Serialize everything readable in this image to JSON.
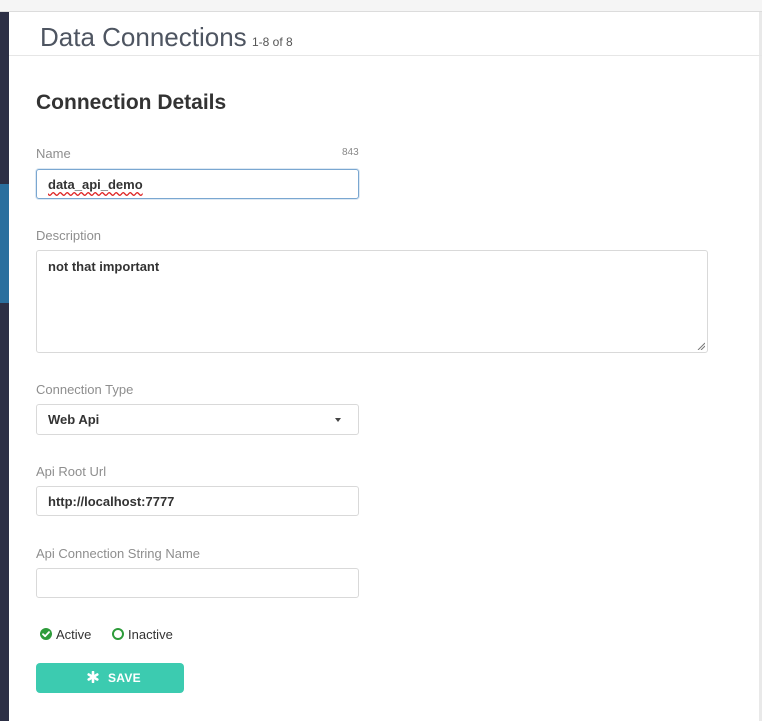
{
  "header": {
    "title": "Data Connections",
    "count": "1-8 of 8"
  },
  "form": {
    "section_title": "Connection Details",
    "name": {
      "label": "Name",
      "value": "data_api_demo",
      "counter": "843"
    },
    "description": {
      "label": "Description",
      "value": "not that important"
    },
    "connection_type": {
      "label": "Connection Type",
      "selected": "Web Api"
    },
    "api_root_url": {
      "label": "Api Root Url",
      "value": "http://localhost:7777"
    },
    "api_connection_string_name": {
      "label": "Api Connection String Name",
      "value": ""
    },
    "status": {
      "options": [
        {
          "label": "Active",
          "checked": true
        },
        {
          "label": "Inactive",
          "checked": false
        }
      ]
    },
    "save_label": "SAVE"
  },
  "colors": {
    "accent": "#3ccbb0",
    "radio": "#2d9b3a",
    "sidebar": "#2c2f45",
    "sidebar_active": "#2a6f9e"
  },
  "icons": {
    "save": "asterisk-icon",
    "select": "caret-down-icon",
    "active": "check-circle-icon",
    "inactive": "circle-outline-icon"
  }
}
